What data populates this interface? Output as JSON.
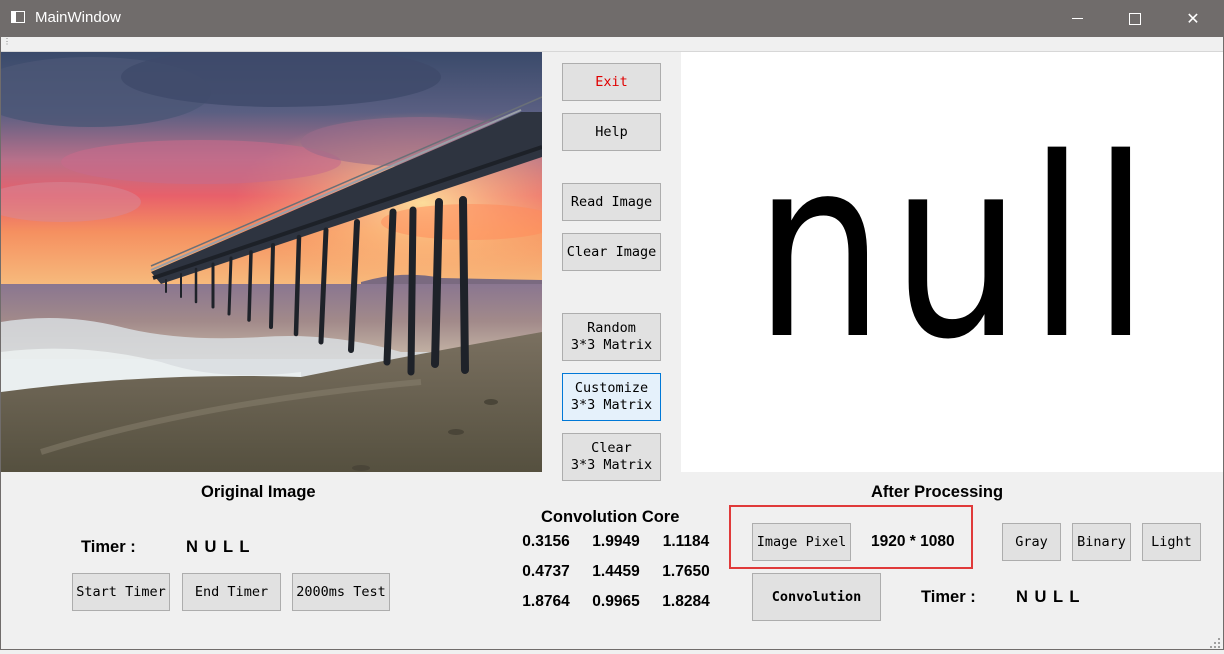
{
  "window": {
    "title": "MainWindow",
    "minimize_glyph": "",
    "maximize_glyph": "",
    "close_glyph": "✕"
  },
  "buttons": {
    "exit": "Exit",
    "help": "Help",
    "read_image": "Read Image",
    "clear_image": "Clear Image",
    "random_line1": "Random",
    "random_line2": "3*3 Matrix",
    "customize_line1": "Customize",
    "customize_line2": "3*3 Matrix",
    "clear_matrix_line1": "Clear",
    "clear_matrix_line2": "3*3 Matrix",
    "start_timer": "Start Timer",
    "end_timer": "End Timer",
    "test_2000ms": "2000ms Test",
    "image_pixel": "Image Pixel",
    "convolution": "Convolution",
    "gray": "Gray",
    "binary": "Binary",
    "light": "Light"
  },
  "labels": {
    "original_image": "Original Image",
    "after_processing": "After Processing",
    "convolution_core": "Convolution Core",
    "timer_left": "Timer :",
    "timer_left_value": "N U L L",
    "timer_right": "Timer :",
    "timer_right_value": "N U L L",
    "pixel_value": "1920 * 1080"
  },
  "processed_image_text": "null",
  "convolution_matrix": [
    [
      "0.3156",
      "1.9949",
      "1.1184"
    ],
    [
      "0.4737",
      "1.4459",
      "1.7650"
    ],
    [
      "1.8764",
      "0.9965",
      "1.8284"
    ]
  ],
  "colors": {
    "title_bar": "#706c6b",
    "window_bg": "#f0f0f0",
    "exit_text": "#e00000",
    "highlight_box": "#e03a3a",
    "focus_border": "#0078d7"
  },
  "icons": {
    "app": "window-icon",
    "minimize": "minimize-icon",
    "maximize": "maximize-icon",
    "close": "close-icon",
    "resize": "resize-grip-icon"
  }
}
